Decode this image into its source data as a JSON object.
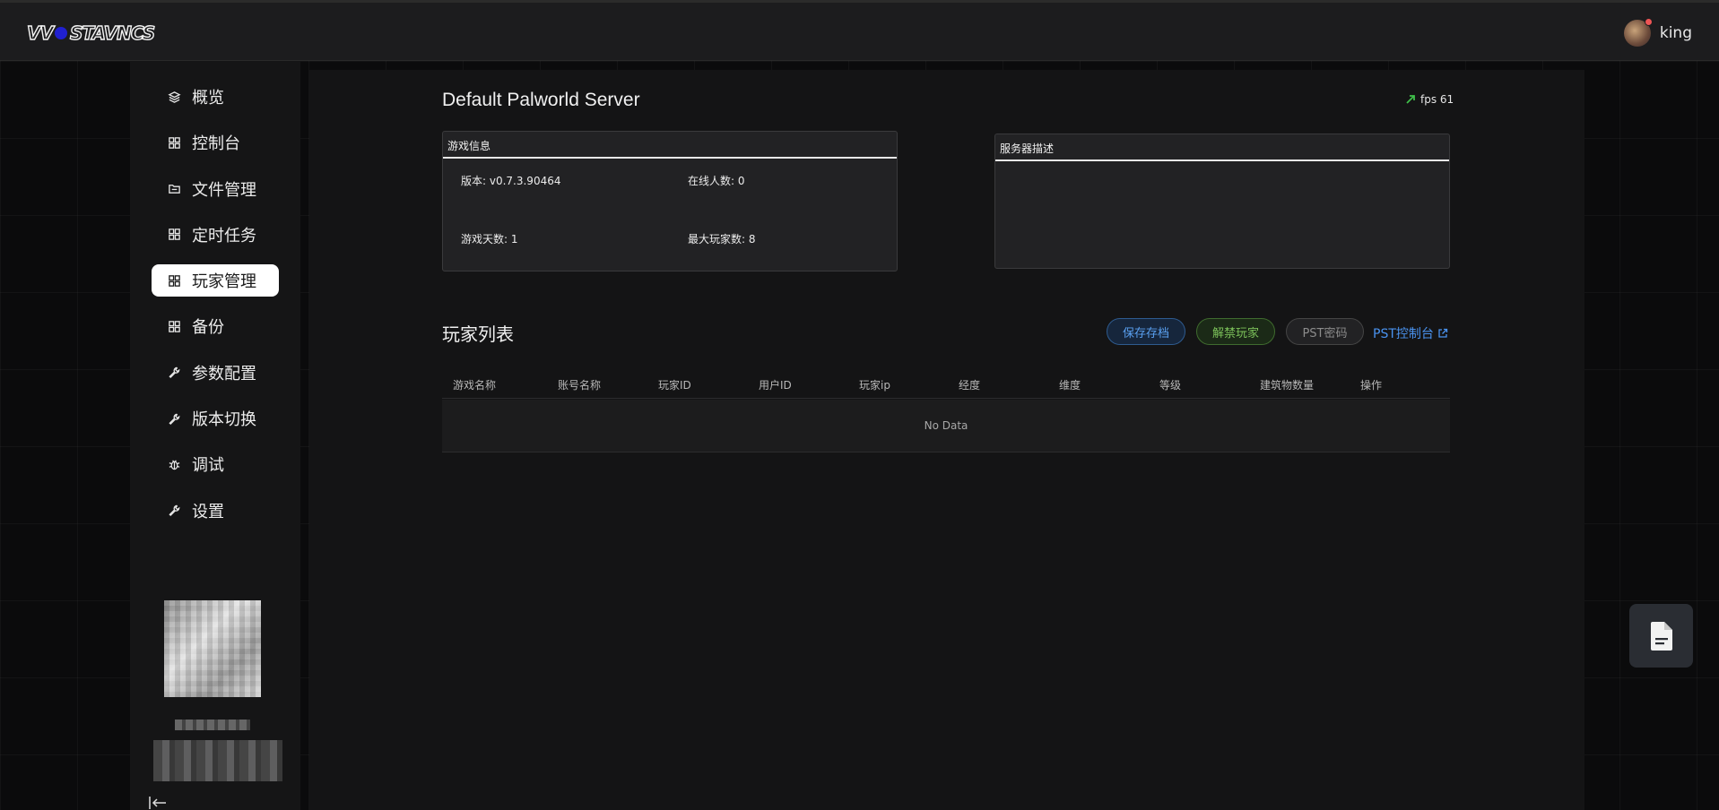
{
  "header": {
    "logo_text": "WOSTAVNCS",
    "username": "king"
  },
  "sidebar": {
    "items": [
      {
        "label": "概览",
        "icon": "layers-icon"
      },
      {
        "label": "控制台",
        "icon": "grid-icon"
      },
      {
        "label": "文件管理",
        "icon": "folder-icon"
      },
      {
        "label": "定时任务",
        "icon": "grid-icon"
      },
      {
        "label": "玩家管理",
        "icon": "grid-icon",
        "active": true
      },
      {
        "label": "备份",
        "icon": "grid-icon"
      },
      {
        "label": "参数配置",
        "icon": "wrench-icon"
      },
      {
        "label": "版本切换",
        "icon": "wrench-icon"
      },
      {
        "label": "调试",
        "icon": "bug-icon"
      },
      {
        "label": "设置",
        "icon": "wrench-icon"
      }
    ]
  },
  "server": {
    "title": "Default Palworld Server",
    "fps_label": "fps 61"
  },
  "game_info": {
    "title": "游戏信息",
    "version": "版本: v0.7.3.90464",
    "online": "在线人数: 0",
    "days": "游戏天数: 1",
    "max_players": "最大玩家数: 8"
  },
  "server_desc": {
    "title": "服务器描述"
  },
  "players": {
    "title": "玩家列表",
    "save_button": "保存存档",
    "unban_button": "解禁玩家",
    "pst_password_button": "PST密码",
    "pst_console_link": "PST控制台",
    "columns": [
      "游戏名称",
      "账号名称",
      "玩家ID",
      "用户ID",
      "玩家ip",
      "经度",
      "维度",
      "等级",
      "建筑物数量",
      "操作"
    ],
    "empty_text": "No Data"
  },
  "colors": {
    "accent_blue": "#4a93f0",
    "accent_green": "#7cc25a",
    "fps_arrow": "#3fbf4a"
  }
}
